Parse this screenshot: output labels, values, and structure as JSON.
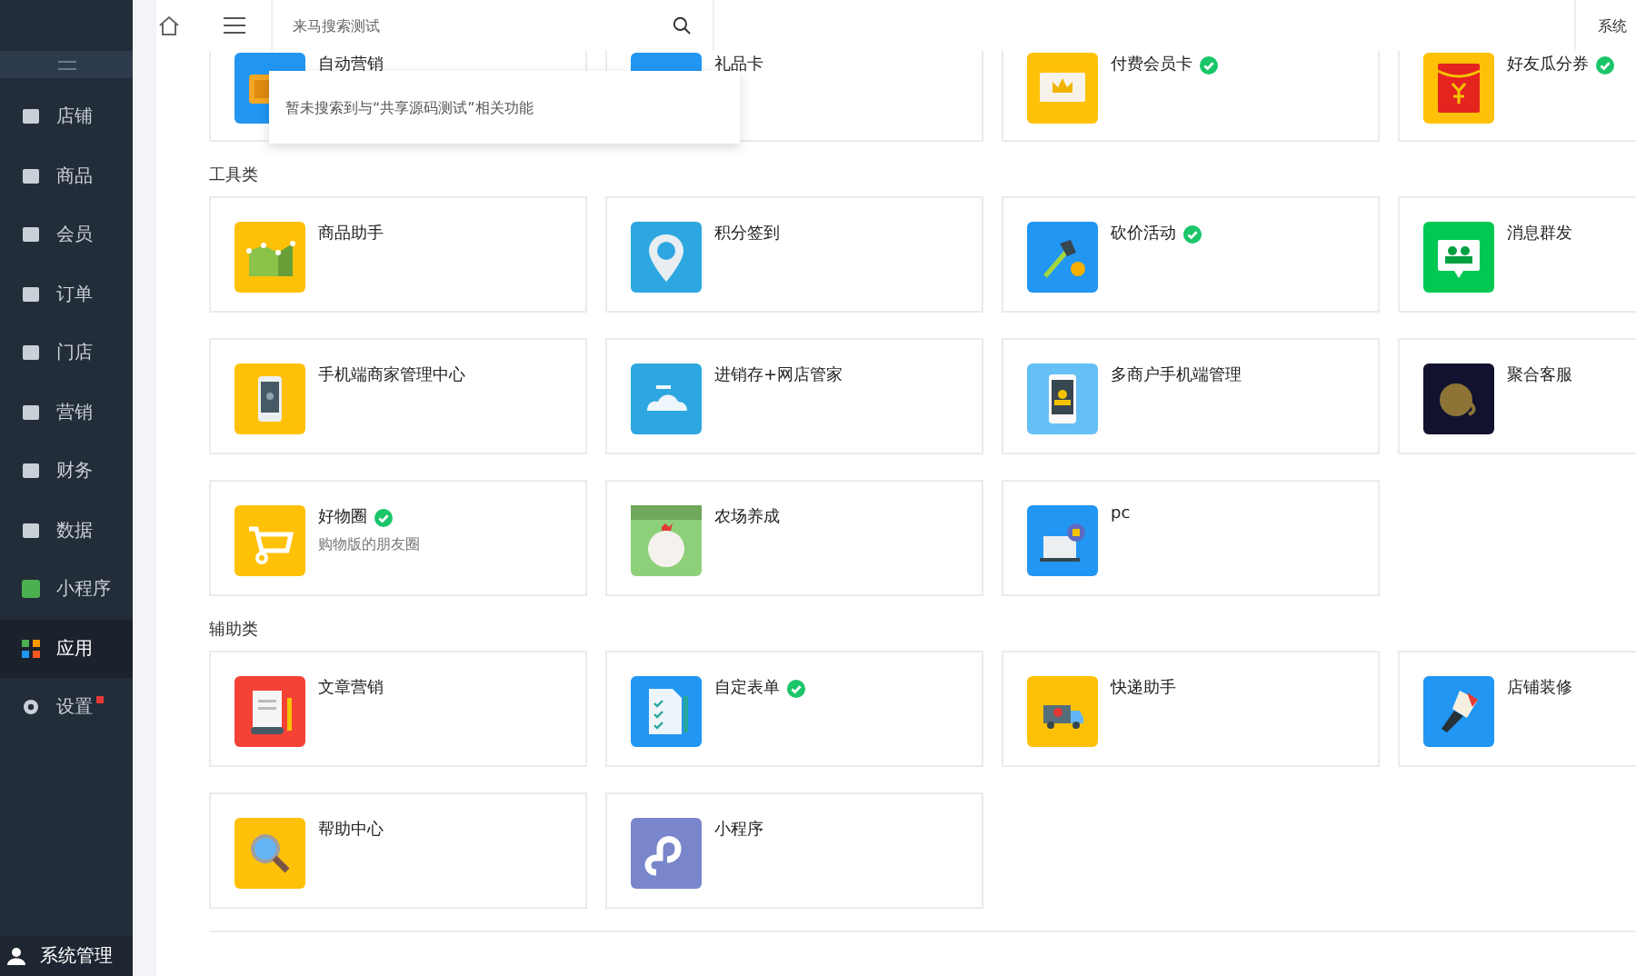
{
  "sidebar": {
    "items": [
      {
        "label": "店铺",
        "selected": false,
        "badge_dot": false
      },
      {
        "label": "商品",
        "selected": false,
        "badge_dot": false
      },
      {
        "label": "会员",
        "selected": false,
        "badge_dot": false
      },
      {
        "label": "订单",
        "selected": false,
        "badge_dot": false
      },
      {
        "label": "门店",
        "selected": false,
        "badge_dot": false
      },
      {
        "label": "营销",
        "selected": false,
        "badge_dot": false
      },
      {
        "label": "财务",
        "selected": false,
        "badge_dot": false
      },
      {
        "label": "数据",
        "selected": false,
        "badge_dot": false
      },
      {
        "label": "小程序",
        "selected": false,
        "badge_dot": false
      },
      {
        "label": "应用",
        "selected": true,
        "badge_dot": false
      },
      {
        "label": "设置",
        "selected": false,
        "badge_dot": true
      }
    ],
    "footer": "系统管理"
  },
  "header": {
    "search": {
      "value": "来马搜索测试"
    },
    "search_result": "暂未搜索到与“共享源码测试”相关功能",
    "right_link": "系统"
  },
  "sections": [
    {
      "apps": [
        {
          "name": "自动营销",
          "verified": false
        },
        {
          "name": "礼品卡",
          "verified": false
        },
        {
          "name": "付费会员卡",
          "verified": true
        },
        {
          "name": "好友瓜分券",
          "verified": true
        }
      ]
    },
    {
      "title": "工具类",
      "apps": [
        {
          "name": "商品助手",
          "verified": false
        },
        {
          "name": "积分签到",
          "verified": false
        },
        {
          "name": "砍价活动",
          "verified": true
        },
        {
          "name": "消息群发",
          "verified": false
        },
        {
          "name": "手机端商家管理中心",
          "verified": false
        },
        {
          "name": "进销存+网店管家",
          "verified": false
        },
        {
          "name": "多商户手机端管理",
          "verified": false
        },
        {
          "name": "聚合客服",
          "verified": false
        },
        {
          "name": "好物圈",
          "verified": true,
          "subtitle": "购物版的朋友圈"
        },
        {
          "name": "农场养成",
          "verified": false
        },
        {
          "name": "pc",
          "verified": false
        }
      ]
    },
    {
      "title": "辅助类",
      "apps": [
        {
          "name": "文章营销",
          "verified": false
        },
        {
          "name": "自定表单",
          "verified": true
        },
        {
          "name": "快递助手",
          "verified": false
        },
        {
          "name": "店铺装修",
          "verified": false
        },
        {
          "name": "帮助中心",
          "verified": false
        },
        {
          "name": "小程序",
          "verified": false
        }
      ]
    }
  ]
}
